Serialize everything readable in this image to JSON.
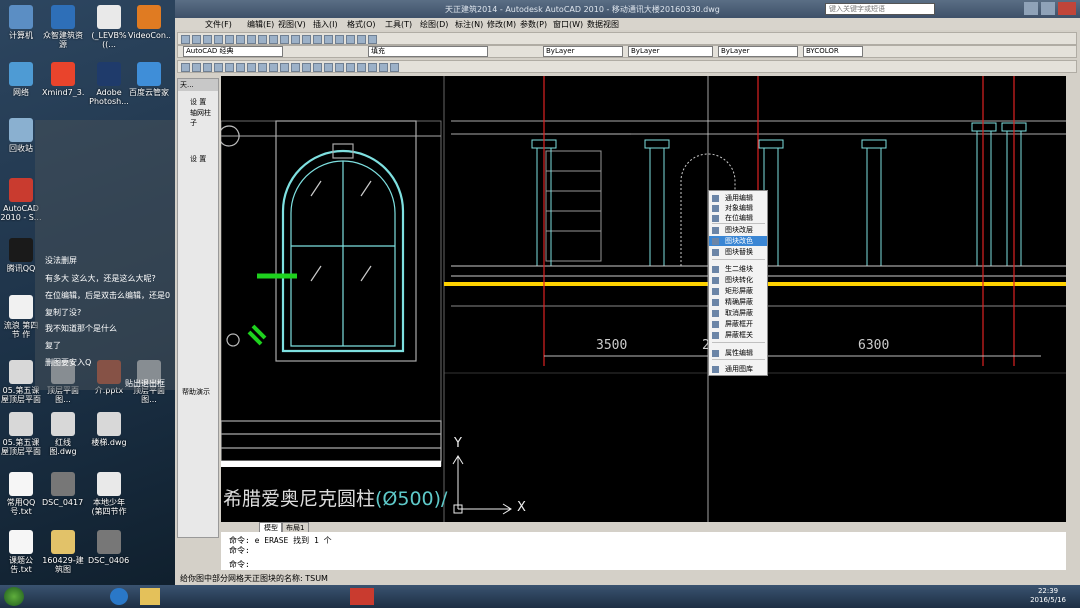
{
  "app": {
    "title": "天正建筑2014 - Autodesk AutoCAD 2010 - 移动通讯大楼20160330.dwg",
    "search_placeholder": "键入关键字或短语"
  },
  "menu": [
    "文件(F)",
    "编辑(E)",
    "视图(V)",
    "插入(I)",
    "格式(O)",
    "工具(T)",
    "绘图(D)",
    "标注(N)",
    "修改(M)",
    "参数(P)",
    "窗口(W)",
    "数据视图"
  ],
  "toolbar": {
    "workspace": "AutoCAD 经典",
    "layer_value": "填充",
    "color": "ByLayer",
    "linetype": "ByLayer",
    "lineweight": "ByLayer",
    "plotstyle": "BYCOLOR"
  },
  "side_panel": {
    "title": "天...",
    "items": [
      "设 置",
      "轴网柱子",
      "设 置",
      "帮助演示"
    ]
  },
  "canvas": {
    "dim_left": "3500",
    "dim_right": "6300",
    "dim_mid": "2",
    "y_axis": "Y",
    "x_axis": "X",
    "col_label": "希腊爱奥尼克圆柱",
    "col_label_suffix": "(Ø500)/",
    "layout_tabs": [
      "模型",
      "布局1"
    ]
  },
  "context_menu": {
    "items": [
      "通用编辑",
      "对象编辑",
      "在位编辑",
      "图块改层",
      "图块改色",
      "图块替换",
      "生二维块",
      "图块转化",
      "矩形屏蔽",
      "精确屏蔽",
      "取消屏蔽",
      "屏蔽框开",
      "屏蔽框关",
      "属性编辑",
      "通用图库"
    ],
    "highlighted_index": 4
  },
  "command_lines": [
    "命令: e ERASE 找到 1 个",
    "命令:",
    "命令:"
  ],
  "status_text": "给你图中部分网格天正图块的名称: TSUM",
  "chat": {
    "lines": [
      "没法删屏",
      "有多大 这么大，还是这么大呢?",
      "在位编辑，后是双击么编辑，还是0",
      "复制了没?",
      "我不知道那个是什么",
      "复了",
      "删图要安入Q"
    ],
    "file_hint": "贴出退出框"
  },
  "desktop_icons": [
    {
      "label": "计算机",
      "icon": "computer-icon"
    },
    {
      "label": "众智建筑资源",
      "icon": "zz-icon"
    },
    {
      "label": "(_LEVB%((...",
      "icon": "doc-icon"
    },
    {
      "label": "VideoCon...",
      "icon": "video-icon"
    },
    {
      "label": "网络",
      "icon": "network-icon"
    },
    {
      "label": "Xmind7_3...",
      "icon": "xmind-icon"
    },
    {
      "label": "Adobe Photosh...",
      "icon": "ps-icon"
    },
    {
      "label": "百度云管家",
      "icon": "baidu-icon"
    },
    {
      "label": "回收站",
      "icon": "recycle-icon"
    },
    {
      "label": "AutoCAD 2010 - S...",
      "icon": "autocad-icon"
    },
    {
      "label": "腾讯QQ",
      "icon": "qq-icon"
    },
    {
      "label": "流浪 第四节 作业.tmp",
      "icon": "file-icon"
    },
    {
      "label": "05.第五课 屋顶层平面图...",
      "icon": "dwg-icon"
    },
    {
      "label": "顶层平面图...",
      "icon": "dwg-icon"
    },
    {
      "label": "介.pptx",
      "icon": "ppt-icon"
    },
    {
      "label": "顶层平面图...",
      "icon": "dwg-icon"
    },
    {
      "label": "05.第五课 屋顶层平面图...",
      "icon": "dwg-icon"
    },
    {
      "label": "红线图.dwg",
      "icon": "dwg-icon"
    },
    {
      "label": "楼梯.dwg",
      "icon": "dwg-icon"
    },
    {
      "label": "常用QQ号.txt",
      "icon": "txt-icon"
    },
    {
      "label": "DSC_0417....",
      "icon": "img-icon"
    },
    {
      "label": "本地少年 (第四节作业...",
      "icon": "doc-icon"
    },
    {
      "label": "课题公告.txt",
      "icon": "txt-icon"
    },
    {
      "label": "160429-建筑图",
      "icon": "folder-icon"
    },
    {
      "label": "DSC_0406....",
      "icon": "img-icon"
    }
  ],
  "taskbar": {
    "time": "22:39",
    "date": "2016/5/16"
  }
}
